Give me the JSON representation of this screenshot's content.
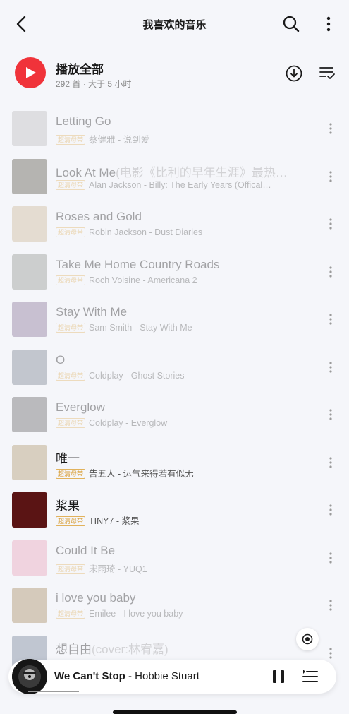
{
  "header": {
    "title": "我喜欢的音乐"
  },
  "play_all": {
    "label": "播放全部",
    "subtitle": "292 首 · 大于 5 小时"
  },
  "badge_label": "超清母带",
  "songs": [
    {
      "title": "Letting Go",
      "title_sub": "",
      "artist_album": "蔡健雅 - 说到爱",
      "cover_color": "#b8b8b8",
      "dimmed": true
    },
    {
      "title": "Look At Me",
      "title_sub": "(电影《比利的早年生涯》最热…",
      "artist_album": "Alan Jackson - Billy: The Early Years (Offical…",
      "cover_color": "#4c4a3a",
      "dimmed": true
    },
    {
      "title": "Roses and Gold",
      "title_sub": "",
      "artist_album": "Robin Jackson - Dust Diaries",
      "cover_color": "#c9b48f",
      "dimmed": true
    },
    {
      "title": "Take Me Home Country Roads",
      "title_sub": "",
      "artist_album": "Roch Voisine - Americana 2",
      "cover_color": "#8a8f86",
      "dimmed": true
    },
    {
      "title": "Stay With Me",
      "title_sub": "",
      "artist_album": "Sam Smith - Stay With Me",
      "cover_color": "#7e6a8e",
      "dimmed": true
    },
    {
      "title": "O",
      "title_sub": "",
      "artist_album": "Coldplay - Ghost Stories",
      "cover_color": "#6f7a86",
      "dimmed": true
    },
    {
      "title": "Everglow",
      "title_sub": "",
      "artist_album": "Coldplay - Everglow",
      "cover_color": "#5a5a5a",
      "dimmed": true
    },
    {
      "title": "唯一",
      "title_sub": "",
      "artist_album": "告五人 - 运气来得若有似无",
      "cover_color": "#d8cfc0",
      "dimmed": false
    },
    {
      "title": "浆果",
      "title_sub": "",
      "artist_album": "TINY7 - 浆果",
      "cover_color": "#5a1414",
      "dimmed": false
    },
    {
      "title": "Could It Be",
      "title_sub": "",
      "artist_album": "宋雨琦 - YUQ1",
      "cover_color": "#e79cb3",
      "dimmed": true
    },
    {
      "title": "i love you baby",
      "title_sub": "",
      "artist_album": "Emilee - I love you baby",
      "cover_color": "#a08455",
      "dimmed": true
    },
    {
      "title": "想自由",
      "title_sub": "(cover:林宥嘉)",
      "artist_album": "",
      "cover_color": "#6a7a8f",
      "dimmed": true
    }
  ],
  "now_playing": {
    "song": "We Can't Stop",
    "separator": " - ",
    "artist": "Hobbie Stuart"
  }
}
